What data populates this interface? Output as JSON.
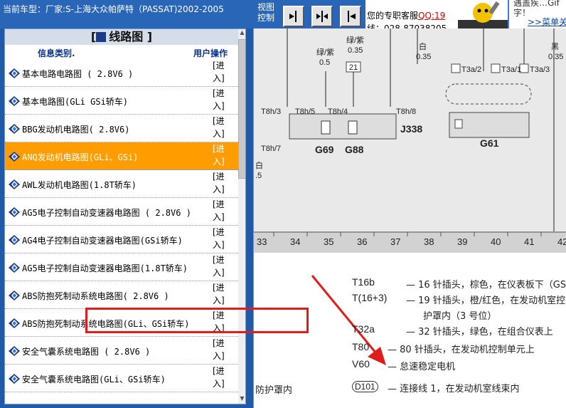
{
  "header": {
    "vehicle_label": "当前车型：厂家:S-上海大众帕萨特（PASSAT)2002-2005",
    "view_control": [
      "视图",
      "控制"
    ]
  },
  "toolbar": {
    "buttons": [
      {
        "name": "fit-page-button",
        "icon": "arrow-into-page"
      },
      {
        "name": "fit-both-button",
        "icon": "arrows-outward"
      },
      {
        "name": "prev-button",
        "icon": "arrow-left"
      }
    ]
  },
  "service": {
    "text": "您的专职客服",
    "qq": "QQ:19",
    "phone": "线：028-87038205"
  },
  "tip": {
    "line1": "遇盖疾…Gif",
    "line2": "字！",
    "link": ">>菜单关"
  },
  "left": {
    "title": "线路图",
    "header": {
      "category": "信息类别.",
      "action": "用户操作"
    },
    "action_label": [
      "[进",
      "入]"
    ],
    "items": [
      "基本电路电路图 ( 2.8V6 )",
      "基本电路图(GLi GSi轿车)",
      "BBG发动机电路图( 2.8V6)",
      "ANQ发动机电路图(GLi、GSi)",
      "AWL发动机电路图(1.8T轿车)",
      "AG5电子控制自动变速器电路图 ( 2.8V6 )",
      "AG4电子控制自动变速器电路图(GSi轿车)",
      "AG5电子控制自动变速器电路图(1.8T轿车)",
      "ABS防抱死制动系统电路图( 2.8V6 )",
      "ABS防抱死制动系统电路图(GLi、GSi轿车)",
      "安全气囊系统电路图 ( 2.8V6 )",
      "安全气囊系统电路图(GLi、GSi轿车)"
    ],
    "selected_index": 3
  },
  "diagram": {
    "wire_labels": [
      {
        "t1": "绿/紫",
        "t2": "0.5"
      },
      {
        "t1": "绿/紫",
        "t2": "0.35"
      },
      {
        "t1": "白",
        "t2": "0.35"
      },
      {
        "t1": "黑",
        "t2": "0.35"
      }
    ],
    "terminal_box": "21",
    "connectors": [
      "T8h/3",
      "T8h/5",
      "T8h/4",
      "T8h/8",
      "T8h/7"
    ],
    "components": [
      "G69",
      "G88",
      "J338",
      "G61"
    ],
    "t3": [
      "T3a/2",
      "T3a/1",
      "T3a/3"
    ],
    "left_wire": {
      "t1": "白",
      "t2": ".5"
    },
    "ruler": [
      "33",
      "34",
      "35",
      "36",
      "37",
      "38",
      "39",
      "40",
      "41",
      "42"
    ]
  },
  "legend": [
    {
      "code": "T16b",
      "desc": "— 16 针插头，棕色，在仪表板下（GS"
    },
    {
      "code": "T(16+3)",
      "desc": "— 19 针插头，橙/红色，在发动机室控"
    },
    {
      "code": "",
      "desc": "护罩内（3 号位）"
    },
    {
      "code": "T32a",
      "desc": "— 32 针插头，绿色，在组合仪表上"
    },
    {
      "code": "T80",
      "desc": "— 80 针插头，在发动机控制单元上"
    },
    {
      "code": "V60",
      "desc": "— 怠速稳定电机"
    },
    {
      "code": "D101",
      "desc": "— 连接线 1，在发动机室线束内"
    }
  ],
  "legend_extra": "防护罩内",
  "colors": {
    "selected_row": "#ff9d00",
    "highlight": "#e01c1c",
    "bar": "#2a66b8"
  }
}
